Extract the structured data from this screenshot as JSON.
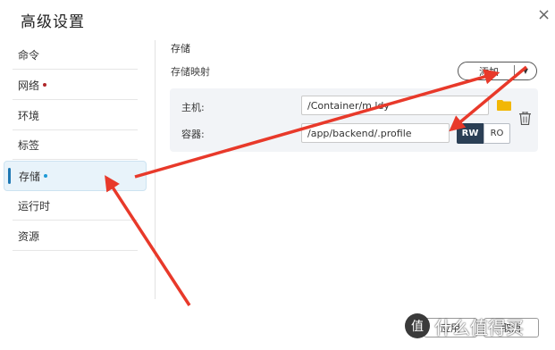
{
  "dialog": {
    "title": "高级设置",
    "close_label": "×"
  },
  "sidebar": {
    "items": [
      {
        "label": "命令"
      },
      {
        "label": "网络",
        "dot_color": "#b0272a"
      },
      {
        "label": "环境"
      },
      {
        "label": "标签"
      },
      {
        "label": "存储",
        "dot_color": "#1e9ad6",
        "active": true
      },
      {
        "label": "运行时"
      },
      {
        "label": "资源"
      }
    ]
  },
  "storage": {
    "section_title": "存储",
    "mapping_label": "存储映射",
    "add_button_label": "添加",
    "host_label": "主机:",
    "host_value": "/Container/m.ldy",
    "container_label": "容器:",
    "container_value": "/app/backend/.profile",
    "rw_label": "RW",
    "ro_label": "RO",
    "selected_mode": "RW"
  },
  "footer": {
    "apply_label": "应用",
    "cancel_label": "取消"
  },
  "watermark": {
    "text": "什么值得买",
    "logo_glyph": "值"
  },
  "colors": {
    "accent": "#1e78b4",
    "annotation_arrow": "#e8392a",
    "folder": "#f2b705",
    "rw_active": "#2b3f55"
  }
}
